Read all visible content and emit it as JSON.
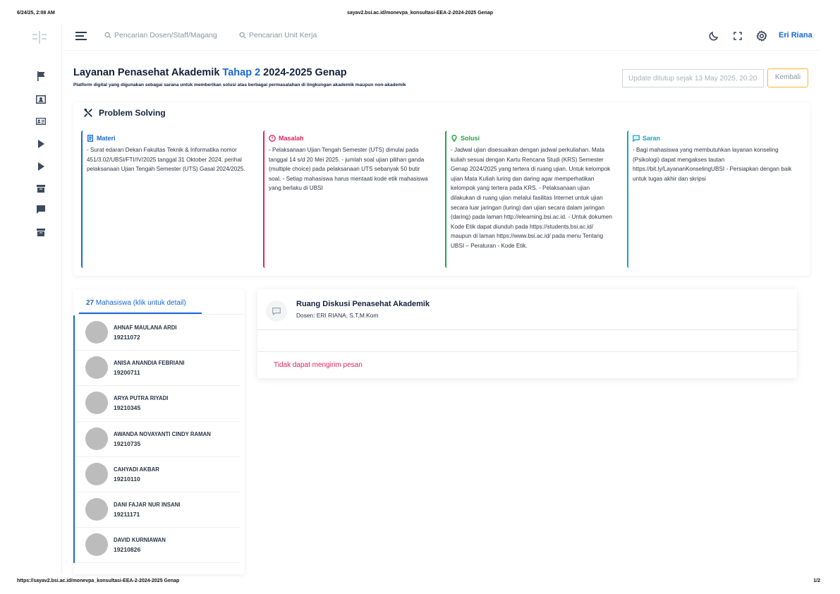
{
  "print": {
    "datetime": "6/24/25, 2:08 AM",
    "page_title": "sayav2.bsi.ac.id/monevpa_konsultasi-EEA-2-2024-2025 Genap",
    "url": "https://sayav2.bsi.ac.id/monevpa_konsultasi-EEA-2-2024-2025 Genap",
    "page_number": "1/2"
  },
  "sidebar": {
    "items": [
      "flag-icon",
      "id-badge-icon",
      "id-card-icon",
      "play-icon",
      "play-icon",
      "archive-icon",
      "chat-icon",
      "archive-icon"
    ]
  },
  "topbar": {
    "search_staff_placeholder": "Pencarian Dosen/Staff/Magang",
    "search_unit_placeholder": "Pencarian Unit Kerja",
    "user_name": "Eri Riana"
  },
  "header": {
    "title_part1": "Layanan Penasehat Akademik ",
    "title_accent": "Tahap 2",
    "title_part2": " 2024-2025 Genap",
    "subtitle": "Platform digital yang digunakan sebagai sarana untuk memberikan solusi atas berbagai permasalahan di lingkungan akademik maupun non-akademik",
    "update_placeholder": "Update ditutup sejak 13 May 2025, 20:20",
    "back_label": "Kembali"
  },
  "problem_solving": {
    "title": "Problem Solving",
    "columns": [
      {
        "head": "Materi",
        "color": "#1668d6",
        "body": "- Surat edaran Dekan Fakultas Teknik & Informatika nomor 451/3.02/UBSI/FTI/IV/2025 tanggal 31 Oktober 2024, perihal pelaksanaan Ujian Tengah Semester (UTS) Gasal 2024/2025."
      },
      {
        "head": "Masalah",
        "color": "#e0245e",
        "body": "- Pelaksanaan Ujian Tengah Semester (UTS) dimulai pada tanggal 14 s/d 20 Mei 2025. - jumlah soal ujian pilihan ganda (multiple choice) pada pelaksanaan UTS sebanyak 50 butir soal. - Setiap mahasiswa harus mentaati kode etik mahasiswa yang berlaku di UBSI"
      },
      {
        "head": "Solusi",
        "color": "#22a447",
        "body": "- Jadwal ujian disesuaikan dengan jadwal perkuliahan. Mata kuliah sesuai dengan Kartu Rencana Studi (KRS) Semester Genap 2024/2025 yang tertera di ruang ujian. Untuk kelompok ujian Mata Kuliah luring dan daring agar memperhatikan kelompok yang tertera pada KRS. - Pelaksanaan ujian dilakukan di ruang ujian melalui fasilitas Internet untuk ujian secara luar jaringan (luring) dan ujian secara dalam jaringan (daring) pada laman http://elearning.bsi.ac.id. - Untuk dokumen Kode Etik dapat diunduh pada https://students.bsi.ac.id/ maupun di laman https://www.bsi.ac.id/ pada menu Tentang UBSI – Peraturan - Kode Etik."
      },
      {
        "head": "Saran",
        "color": "#12a4c9",
        "body": "- Bagi mahasiswa yang membutuhkan layanan konseling (Psikologi) dapat mengakses tautan https://bit.ly/LayananKonselingUBSI - Persiapkan dengan baik untuk tugas akhir dan skripsi"
      }
    ]
  },
  "students": {
    "count": "27",
    "tab_label": " Mahasiswa (klik untuk detail)",
    "items": [
      {
        "name": "AHNAF MAULANA ARDI",
        "nim": "19211072"
      },
      {
        "name": "ANISA ANANDIA FEBRIANI",
        "nim": "19200711"
      },
      {
        "name": "ARYA PUTRA RIYADI",
        "nim": "19210345"
      },
      {
        "name": "AWANDA NOVAYANTI CINDY RAMAN",
        "nim": "19210735"
      },
      {
        "name": "CAHYADI AKBAR",
        "nim": "19210110"
      },
      {
        "name": "DANI FAJAR NUR INSANI",
        "nim": "19211171"
      },
      {
        "name": "DAVID KURNIAWAN",
        "nim": "19210826"
      }
    ]
  },
  "discussion": {
    "title": "Ruang Diskusi Penasehat Akademik",
    "dosen": "Dosen: ERI RIANA, S.T,M.Kom",
    "error": "Tidak dapat mengirim pesan"
  }
}
